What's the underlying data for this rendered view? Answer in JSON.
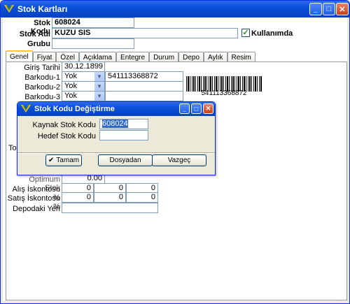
{
  "window": {
    "title": "Stok Kartları"
  },
  "header": {
    "stok_kodu_label": "Stok Kodu",
    "stok_kodu_value": "608024",
    "stok_adi_label": "Stok Adı",
    "stok_adi_value": "KUZU SIS",
    "kullanimda_label": "Kullanımda",
    "grubu_label": "Grubu",
    "grubu_value": ""
  },
  "tabs": [
    "Genel",
    "Fiyat",
    "Özel",
    "Açıklama",
    "Entegre",
    "Durum",
    "Depo",
    "Aylık",
    "Resim"
  ],
  "genel": {
    "giris_tarihi_label": "Giriş Tarihi",
    "giris_tarihi_value": "30.12.1899",
    "barkodu1_label": "Barkodu-1",
    "barkodu1_type": "Yok",
    "barkodu1_value": "541113368872",
    "barkodu2_label": "Barkodu-2",
    "barkodu2_type": "Yok",
    "barkodu3_label": "Barkodu-3",
    "barkodu3_type": "Yok",
    "barcode_text": "541113368872",
    "partial_left_label": "To",
    "optimum_stok_label": "Optimum Stok",
    "optimum_stok_value": "0.00",
    "alis_iskonto_label": "Alış İskontosu %",
    "alis_iskonto_values": [
      "0",
      "0",
      "0"
    ],
    "satis_iskonto_label": "Satış İskontosu %",
    "satis_iskonto_values": [
      "0",
      "0",
      "0"
    ],
    "depodaki_yeri_label": "Depodaki Yeri",
    "depodaki_yeri_value": ""
  },
  "dialog": {
    "title": "Stok Kodu Değiştirme",
    "kaynak_label": "Kaynak Stok Kodu",
    "kaynak_value": "608024",
    "hedef_label": "Hedef Stok Kodu",
    "hedef_value": "",
    "tamam_label": "Tamam",
    "dosyadan_label": "Dosyadan",
    "vazgec_label": "Vazgeç"
  }
}
